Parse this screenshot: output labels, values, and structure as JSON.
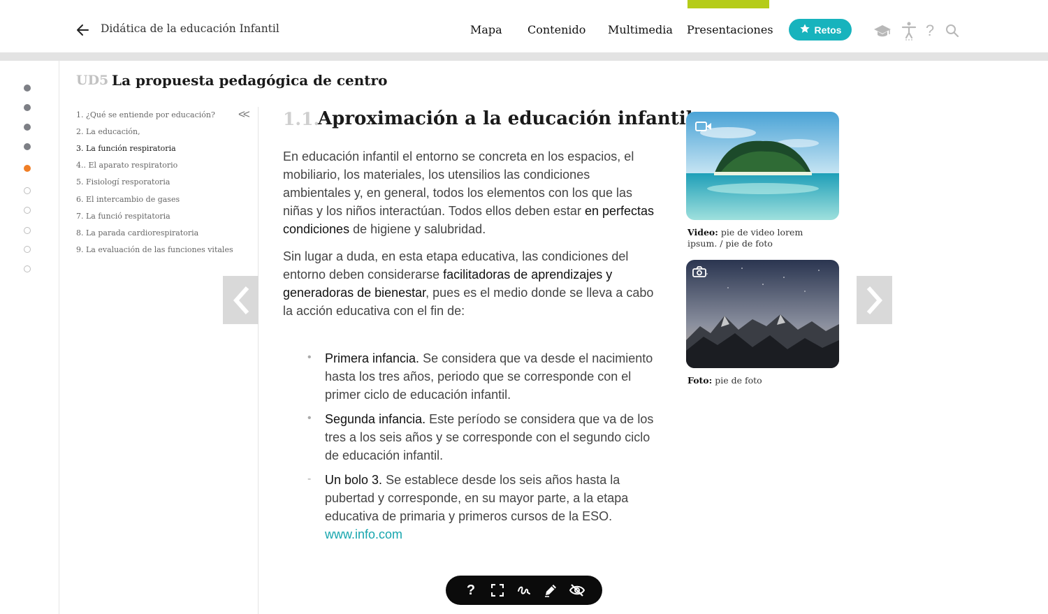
{
  "header": {
    "course_title": "Didática de la educación Infantil",
    "nav": [
      "Mapa",
      "Contenido",
      "Multimedia",
      "Presentaciones"
    ],
    "active_nav": "Presentaciones",
    "retos_label": "Retos",
    "help_glyph": "?",
    "accent_color": "#b5cc18",
    "brand_color": "#17b3bd"
  },
  "progress": {
    "total": 10,
    "completed": 4,
    "current": 5
  },
  "unit": {
    "code": "UD5",
    "title": "La propuesta pedagógica de centro"
  },
  "toc": {
    "collapse_glyph": "<<",
    "items": [
      "1. ¿Qué se entiende por educación?",
      "2. La educación,",
      "3. La función respiratoria",
      "4.. El aparato respiratorio",
      "5. Fisiologí resporatoria",
      "6. El intercambio de gases",
      "7. La funció respitatoria",
      "8. La parada cardiorespiratoria",
      "9. La evaluación de las funciones vitales"
    ],
    "active_index": 2
  },
  "section": {
    "number": "1.1.",
    "title": "Aproximación a la educación infantil",
    "p1_text": "En educación infantil el entorno se concreta en los espacios, el mobiliario, los materiales, los utensilios  las condiciones ambientales y, en general, todos los elementos con los que las niñas y los niños interactúan. Todos ellos deben estar ",
    "p1_bold": "en perfectas condiciones",
    "p1_end": " de higiene y salubridad.",
    "p2_text": "Sin lugar a duda, en esta etapa educativa, las condiciones del entorno deben considerarse ",
    "p2_bold": "facilitadoras de aprendizajes y generadoras de bienestar",
    "p2_end": ", pues es el medio donde se lleva a cabo la acción educativa con el fin de:",
    "list": [
      {
        "marker": "•",
        "bold": "Primera infancia.",
        "text": " Se considera que va desde el nacimiento hasta los tres años, periodo que se corresponde con el primer ciclo de educación infantil."
      },
      {
        "marker": "•",
        "bold": "Segunda infancia.",
        "text": " Este período se considera que va de los tres a los seis años y se corresponde con el segundo ciclo de educación infantil."
      },
      {
        "marker": "-",
        "bold": "Un bolo 3.",
        "text": " Se establece desde los seis años hasta la pubertad y corresponde, en su mayor parte, a la etapa educativa de primaria y primeros cursos de la ESO. ",
        "link": "www.info.com"
      }
    ]
  },
  "media": [
    {
      "type": "video",
      "icon": "video-camera-icon",
      "caption_label": "Video:",
      "caption_text": " pie de video lorem ipsum. / pie de foto"
    },
    {
      "type": "photo",
      "icon": "camera-icon",
      "caption_label": "Foto:",
      "caption_text": " pie de foto"
    }
  ],
  "toolbar": {
    "help_glyph": "?",
    "icons": [
      "help-icon",
      "fullscreen-icon",
      "draw-icon",
      "edit-pen-icon",
      "hide-icon"
    ]
  }
}
